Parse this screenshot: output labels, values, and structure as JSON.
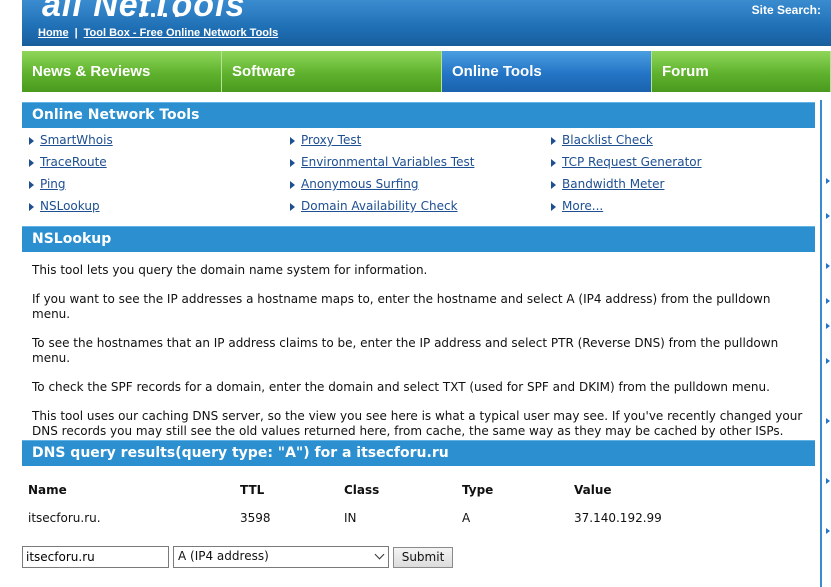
{
  "header": {
    "logo_text": "all NetTools",
    "site_search_label": "Site Search:",
    "breadcrumb": [
      {
        "label": "Home"
      },
      {
        "label": "Tool Box - Free Online Network Tools"
      }
    ],
    "breadcrumb_separator": "|"
  },
  "nav": {
    "items": [
      {
        "label": "News & Reviews",
        "active": false
      },
      {
        "label": "Software",
        "active": false
      },
      {
        "label": "Online Tools",
        "active": true
      },
      {
        "label": "Forum",
        "active": false
      }
    ]
  },
  "tools_section": {
    "title": "Online Network Tools",
    "columns": [
      [
        "SmartWhois",
        "TraceRoute",
        "Ping",
        "NSLookup"
      ],
      [
        "Proxy Test",
        "Environmental Variables Test",
        "Anonymous Surfing",
        "Domain Availability Check"
      ],
      [
        "Blacklist Check",
        "TCP Request Generator",
        "Bandwidth Meter",
        "More..."
      ]
    ]
  },
  "nslookup_section": {
    "title": "NSLookup",
    "paragraphs": [
      "This tool lets you query the domain name system for information.",
      "If you want to see the IP addresses a hostname maps to, enter the hostname and select A (IP4 address) from the pulldown menu.",
      "To see the hostnames that an IP address claims to be, enter the IP address and select PTR (Reverse DNS) from the pulldown menu.",
      "To check the SPF records for a domain, enter the domain and select TXT (used for SPF and DKIM) from the pulldown menu.",
      "This tool uses our caching DNS server, so the view you see here is what a typical user may see. If you've recently changed your DNS records you may still see the old values returned here, from cache, the same way as they may be cached by other ISPs."
    ]
  },
  "results_section": {
    "title": "DNS query results(query type: \"A\") for a itsecforu.ru",
    "columns": [
      "Name",
      "TTL",
      "Class",
      "Type",
      "Value"
    ],
    "rows": [
      [
        "itsecforu.ru.",
        "3598",
        "IN",
        "A",
        "37.140.192.99"
      ]
    ]
  },
  "form": {
    "hostname_value": "itsecforu.ru",
    "query_type_selected": "A (IP4 address)",
    "submit_label": "Submit"
  },
  "colors": {
    "header_blue": "#1f6fb5",
    "nav_green": "#5fb22d",
    "nav_active_blue": "#2475c6",
    "section_bar": "#2b8fd0",
    "link": "#1d4f91"
  }
}
